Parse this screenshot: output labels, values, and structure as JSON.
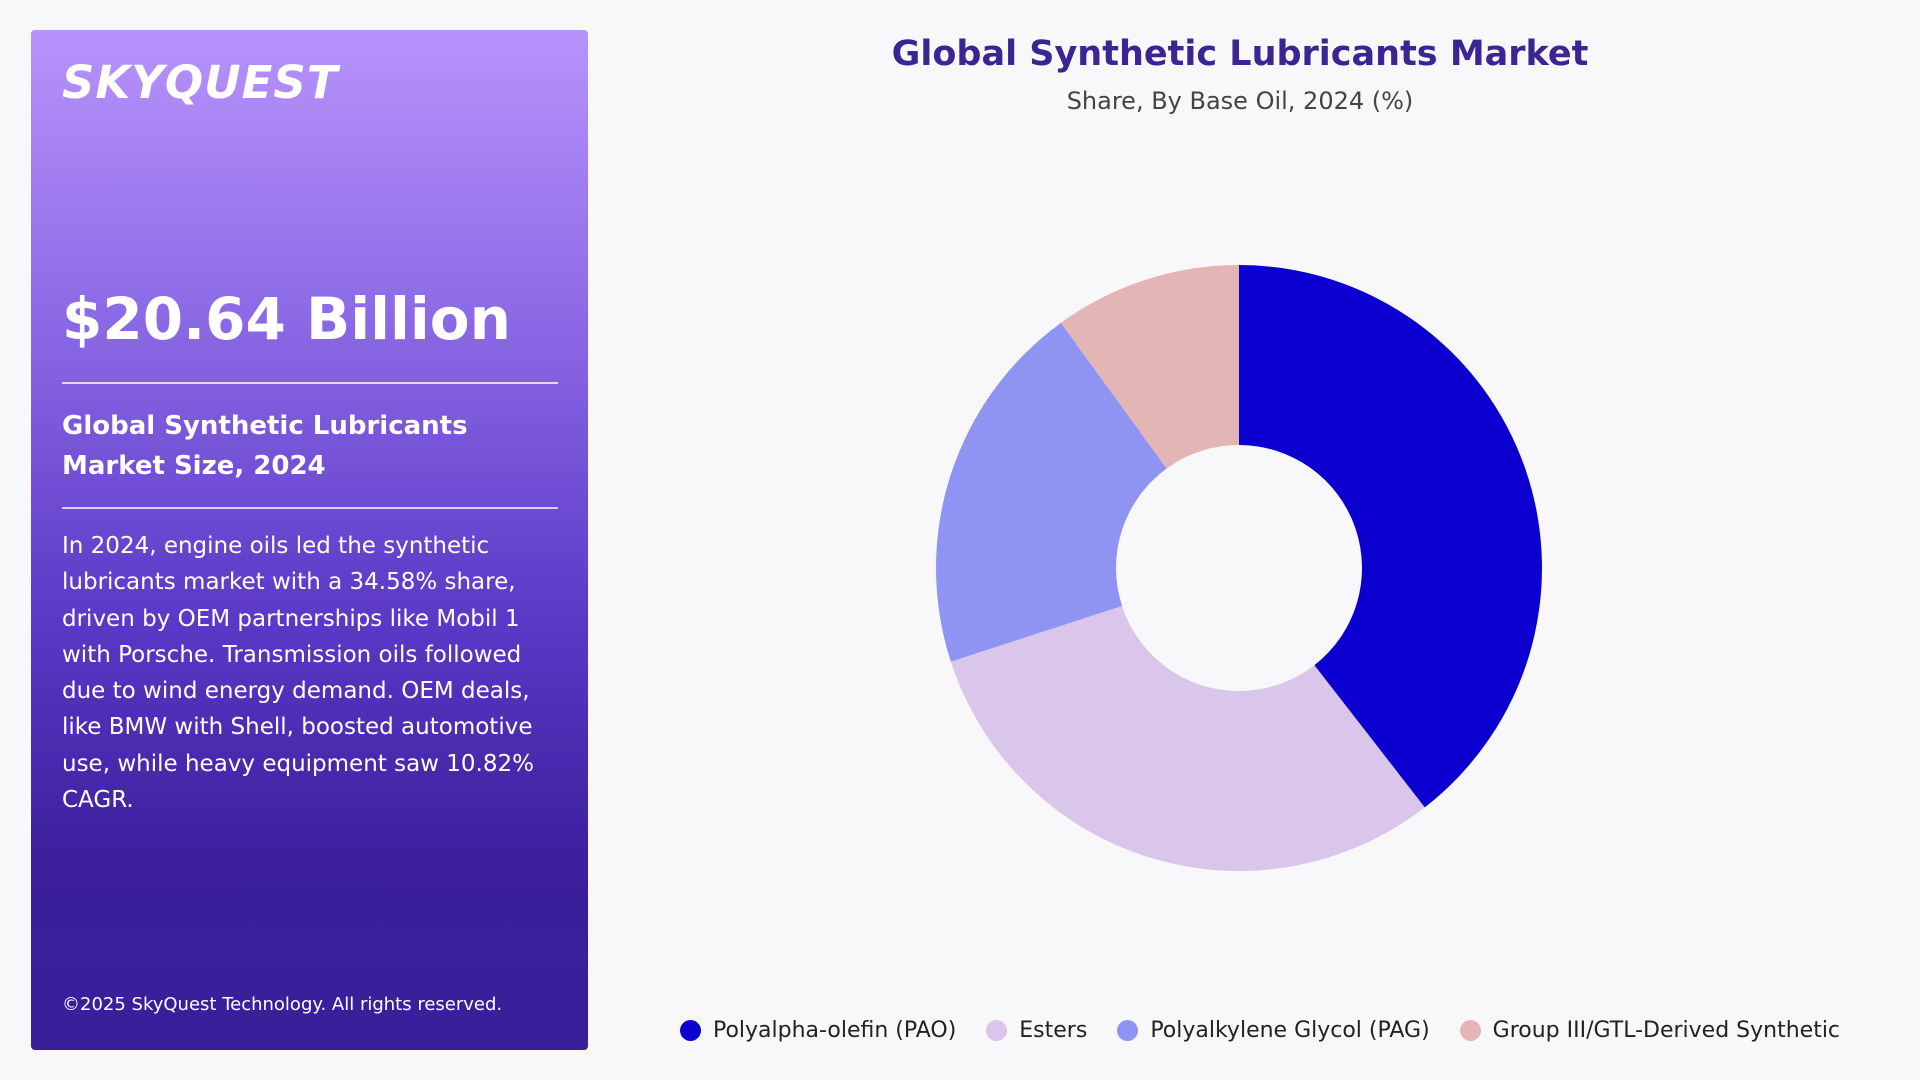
{
  "panel": {
    "brand": "SKYQUEST",
    "value": "$20.64 Billion",
    "size_label": "Global Synthetic Lubricants Market Size, 2024",
    "summary": "In 2024, engine oils led the synthetic lubricants market with a 34.58% share, driven by OEM partnerships like Mobil 1 with Porsche. Transmission oils followed due to wind energy demand. OEM deals, like BMW with Shell, boosted automotive use, while heavy equipment saw 10.82% CAGR.",
    "copyright": "©2025 SkyQuest Technology. All rights reserved."
  },
  "chart_data": {
    "type": "pie",
    "donut": true,
    "title": "Global Synthetic Lubricants Market",
    "subtitle": "Share, By Base Oil, 2024 (%)",
    "categories": [
      "Polyalpha-olefin (PAO)",
      "Esters",
      "Polyalkylene Glycol (PAG)",
      "Group III/GTL-Derived Synthetic"
    ],
    "values": [
      39.5,
      30.5,
      20.0,
      10.0
    ],
    "colors": [
      "#0c00d1",
      "#dac5eb",
      "#8f94f2",
      "#e3b5b5"
    ],
    "legend_position": "bottom"
  },
  "colors": {
    "panel_top": "#b893fb",
    "panel_bottom": "#38209a",
    "title": "#3a2593"
  }
}
